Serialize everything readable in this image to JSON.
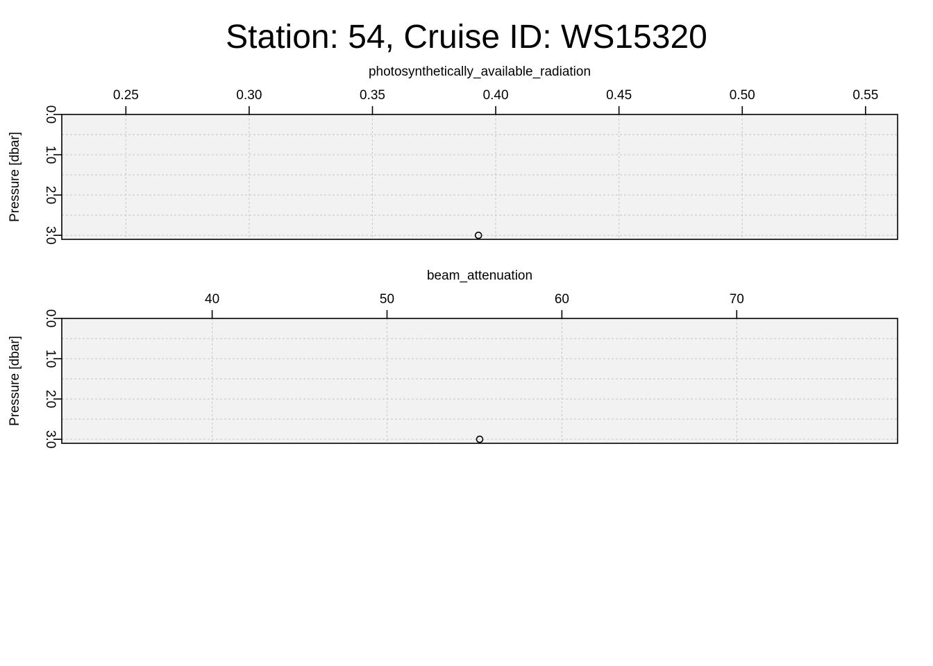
{
  "title": "Station: 54, Cruise ID: WS15320",
  "chart_data": [
    {
      "type": "scatter",
      "title": "",
      "xlabel": "photosynthetically_available_radiation",
      "ylabel": "Pressure [dbar]",
      "x_axis_position": "top",
      "y_inverted": true,
      "xlim": [
        0.224,
        0.563
      ],
      "ylim": [
        0.0,
        3.1
      ],
      "x_ticks": [
        0.25,
        0.3,
        0.35,
        0.4,
        0.45,
        0.5,
        0.55
      ],
      "x_tick_labels": [
        "0.25",
        "0.30",
        "0.35",
        "0.40",
        "0.45",
        "0.50",
        "0.55"
      ],
      "y_ticks": [
        0.0,
        1.0,
        2.0,
        3.0
      ],
      "y_tick_labels": [
        "0.0",
        "1.0",
        "2.0",
        "3.0"
      ],
      "y_grid": [
        0.0,
        0.5,
        1.0,
        1.5,
        2.0,
        2.5,
        3.0
      ],
      "grid": true,
      "marker": "open-circle",
      "points": [
        {
          "x": 0.393,
          "y": 3.0
        }
      ]
    },
    {
      "type": "scatter",
      "title": "",
      "xlabel": "beam_attenuation",
      "ylabel": "Pressure [dbar]",
      "x_axis_position": "top",
      "y_inverted": true,
      "xlim": [
        31.4,
        79.2
      ],
      "ylim": [
        0.0,
        3.1
      ],
      "x_ticks": [
        40,
        50,
        60,
        70
      ],
      "x_tick_labels": [
        "40",
        "50",
        "60",
        "70"
      ],
      "y_ticks": [
        0.0,
        1.0,
        2.0,
        3.0
      ],
      "y_tick_labels": [
        "0.0",
        "1.0",
        "2.0",
        "3.0"
      ],
      "y_grid": [
        0.0,
        0.5,
        1.0,
        1.5,
        2.0,
        2.5,
        3.0
      ],
      "grid": true,
      "marker": "open-circle",
      "points": [
        {
          "x": 55.3,
          "y": 3.0
        }
      ]
    }
  ]
}
